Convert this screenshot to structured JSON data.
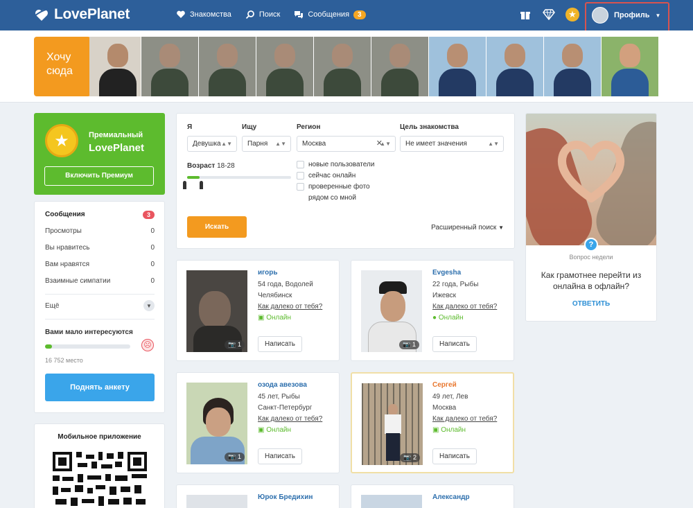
{
  "header": {
    "logo": "LovePlanet",
    "nav": [
      {
        "label": "Знакомства",
        "icon": "heart-icon"
      },
      {
        "label": "Поиск",
        "icon": "search-icon"
      },
      {
        "label": "Сообщения",
        "icon": "chat-icon",
        "badge": "3"
      }
    ],
    "icons": [
      "gift-icon",
      "diamond-icon",
      "star-coin-icon"
    ],
    "profile_label": "Профиль"
  },
  "strip": {
    "want_here": "Хочу сюда"
  },
  "premium": {
    "line1": "Премиальный",
    "line2": "LovePlanet",
    "button": "Включить Премиум"
  },
  "stats": {
    "messages": {
      "label": "Сообщения",
      "count": "3"
    },
    "rows": [
      {
        "label": "Просмотры",
        "value": "0"
      },
      {
        "label": "Вы нравитесь",
        "value": "0"
      },
      {
        "label": "Вам нравятся",
        "value": "0"
      },
      {
        "label": "Взаимные симпатии",
        "value": "0"
      }
    ],
    "more": "Ещё",
    "interest_title": "Вами мало интересуются",
    "interest_level": 0.08,
    "place": "16 752 место",
    "raise_button": "Поднять анкету"
  },
  "mobile": {
    "title": "Мобильное приложение"
  },
  "filter": {
    "i_label": "Я",
    "i_value": "Девушка",
    "seek_label": "Ищу",
    "seek_value": "Парня",
    "region_label": "Регион",
    "region_value": "Москва",
    "goal_label": "Цель знакомства",
    "goal_value": "Не имеет значения",
    "age_label": "Возраст",
    "age_value": "18-28",
    "checks": [
      "новые пользователи",
      "сейчас онлайн",
      "проверенные фото",
      "рядом со мной"
    ],
    "search_button": "Искать",
    "advanced": "Расширенный поиск"
  },
  "cards": [
    {
      "name": "игорь",
      "info": "54 года, Водолей",
      "city": "Челябинск",
      "link": "Как далеко от тебя?",
      "online": "Онлайн",
      "photos": "1",
      "button": "Написать"
    },
    {
      "name": "Evgesha",
      "info": "22 года, Рыбы",
      "city": "Ижевск",
      "link": "Как далеко от тебя?",
      "online": "Онлайн",
      "photos": "1",
      "button": "Написать"
    },
    {
      "name": "озода авезова",
      "info": "45 лет, Рыбы",
      "city": "Санкт-Петербург",
      "link": "Как далеко от тебя?",
      "online": "Онлайн",
      "photos": "1",
      "button": "Написать"
    },
    {
      "name": "Сергей",
      "info": "49 лет, Лев",
      "city": "Москва",
      "link": "Как далеко от тебя?",
      "online": "Онлайн",
      "photos": "2",
      "button": "Написать"
    },
    {
      "name": "Юрок Бредихин"
    },
    {
      "name": "Александр"
    }
  ],
  "question": {
    "week": "Вопрос недели",
    "text": "Как грамотнее перейти из онлайна в офлайн?",
    "answer": "ОТВЕТИТЬ"
  },
  "colors": {
    "header": "#2d5f9a",
    "accent_orange": "#f39a1f",
    "premium_green": "#5dbb2e",
    "link_blue": "#2d6fad",
    "raise_blue": "#3aa5ea",
    "badge_red": "#e9555f"
  }
}
